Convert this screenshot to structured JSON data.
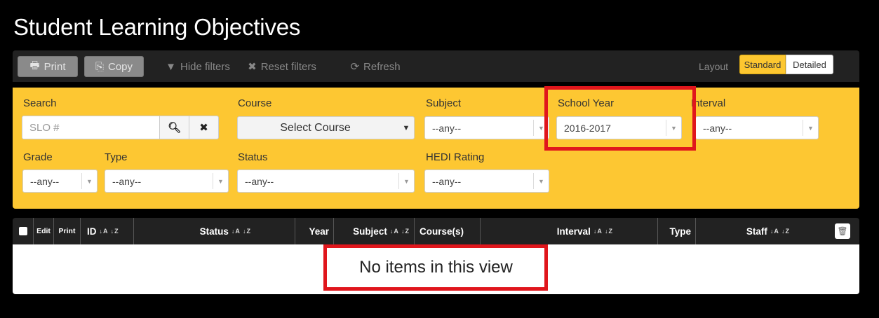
{
  "page": {
    "title": "Student Learning Objectives"
  },
  "toolbar": {
    "print_label": "Print",
    "copy_label": "Copy",
    "hide_filters_label": "Hide filters",
    "reset_filters_label": "Reset filters",
    "refresh_label": "Refresh",
    "layout_label": "Layout",
    "layout_standard_label": "Standard",
    "layout_detailed_label": "Detailed"
  },
  "filters": {
    "search": {
      "label": "Search",
      "placeholder": "SLO #"
    },
    "course": {
      "label": "Course",
      "value": "Select Course"
    },
    "subject": {
      "label": "Subject",
      "value": "--any--"
    },
    "school_year": {
      "label": "School Year",
      "value": "2016-2017"
    },
    "interval": {
      "label": "Interval",
      "value": "--any--"
    },
    "grade": {
      "label": "Grade",
      "value": "--any--"
    },
    "type": {
      "label": "Type",
      "value": "--any--"
    },
    "status": {
      "label": "Status",
      "value": "--any--"
    },
    "hedi": {
      "label": "HEDI Rating",
      "value": "--any--"
    }
  },
  "table": {
    "columns": {
      "edit": "Edit",
      "print": "Print",
      "id": "ID",
      "status": "Status",
      "year": "Year",
      "subject": "Subject",
      "courses": "Course(s)",
      "interval": "Interval",
      "type": "Type",
      "staff": "Staff"
    },
    "empty_message": "No items in this view"
  },
  "colors": {
    "accent": "#fdc732",
    "highlight": "#e0161c",
    "header": "#222222"
  }
}
